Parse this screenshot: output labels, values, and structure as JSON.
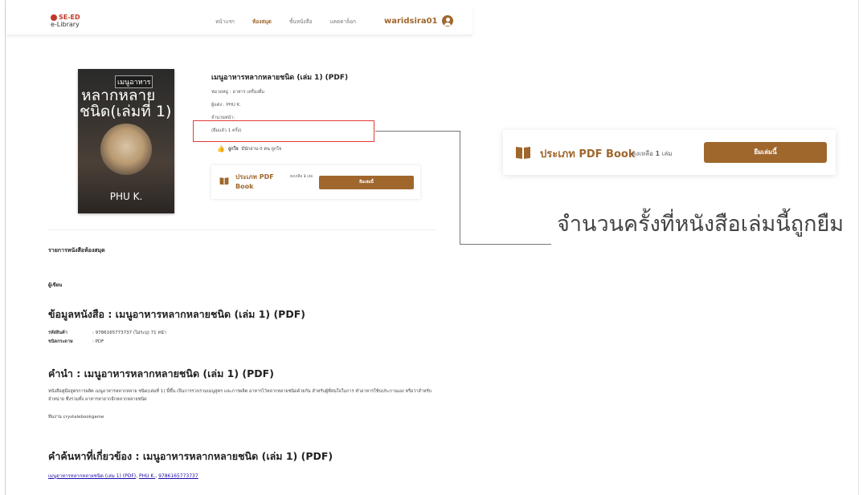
{
  "header": {
    "logo_top": "SE-ED",
    "logo_bottom": "e-Library",
    "nav": [
      "หน้าแรก",
      "ห้องสมุด",
      "ชั้นหนังสือ",
      "แคตตาล็อก"
    ],
    "nav_active_index": 1,
    "username": "waridsira01"
  },
  "cover": {
    "subtitle": "เมนูอาหาร",
    "title_line1": "หลากหลาย",
    "title_line2": "ชนิด(เล่มที่ 1)",
    "author": "PHU K."
  },
  "book": {
    "title": "เมนูอาหารหลากหลายชนิด (เล่ม 1) (PDF)",
    "category": "หมวดหมู่ : อาหาร เครื่องดื่ม",
    "author": "ผู้แต่ง : PHU K.",
    "pages": "จำนวนหน้า:",
    "borrowed": "(ยืมแล้ว 1 ครั้ง)",
    "like_label": "ถูกใจ",
    "like_count": "มีนักอ่าน 0 คน ถูกใจ"
  },
  "borrow_small": {
    "type": "ประเภท PDF Book",
    "remain_prefix": "คงเหลือ",
    "remain_count": "1",
    "remain_unit": "เล่ม",
    "button": "ยืมเล่มนี้"
  },
  "sections": {
    "library_list": "รายการหนังสือห้องสมุด",
    "author_heading": "ผู้เขียน",
    "info_heading": "ข้อมูลหนังสือ : เมนูอาหารหลากหลายชนิด (เล่ม 1) (PDF)",
    "sku_label": "รหัสสินค้า",
    "sku_value": ": 9786165773737 (ไม่ระบุ) 71 หน้า",
    "paper_label": "ชนิดกระดาษ",
    "paper_value": ": PDF",
    "intro_heading": "คำนำ : เมนูอาหารหลากหลายชนิด (เล่ม 1) (PDF)",
    "intro_text": "หนังสือคู่มือสูตรการผลิต เมนูอาหารหลากหลาย ชนิด(เล่มที่ 1) นี้ขึ้น เป็นการรวบรวมเมนูสูตร และการผลิต อาหารไว้หลากหลายชนิดด้วยกัน สำหรับผู้ที่สนใจในการ ทำอาหารใช้นประกานเอง หรือว่าสำหรับจำหน่าย ซึ่งรวมทั้ง อาหารหายากอีกหลากหลายชนิด",
    "intro_sign": "ทีมงาน crystalebookgame",
    "related_heading": "คำค้นหาที่เกี่ยวข้อง : เมนูอาหารหลากหลายชนิด (เล่ม 1) (PDF)",
    "related_links": [
      "เมนูอาหารหลากหลายชนิด (เล่ม 1) (PDF)",
      "PHU K.",
      "9786165773737"
    ]
  },
  "callout": {
    "type": "ประเภท PDF Book",
    "remain_prefix": "คงเหลือ",
    "remain_count": "1",
    "remain_unit": "เล่ม",
    "button": "ยืมเล่มนี้",
    "annotation": "จำนวนครั้งที่หนังสือเล่มนี้ถูกยืม"
  },
  "colors": {
    "accent": "#a0672d",
    "highlight": "#e53935",
    "link": "#1a0dab"
  }
}
